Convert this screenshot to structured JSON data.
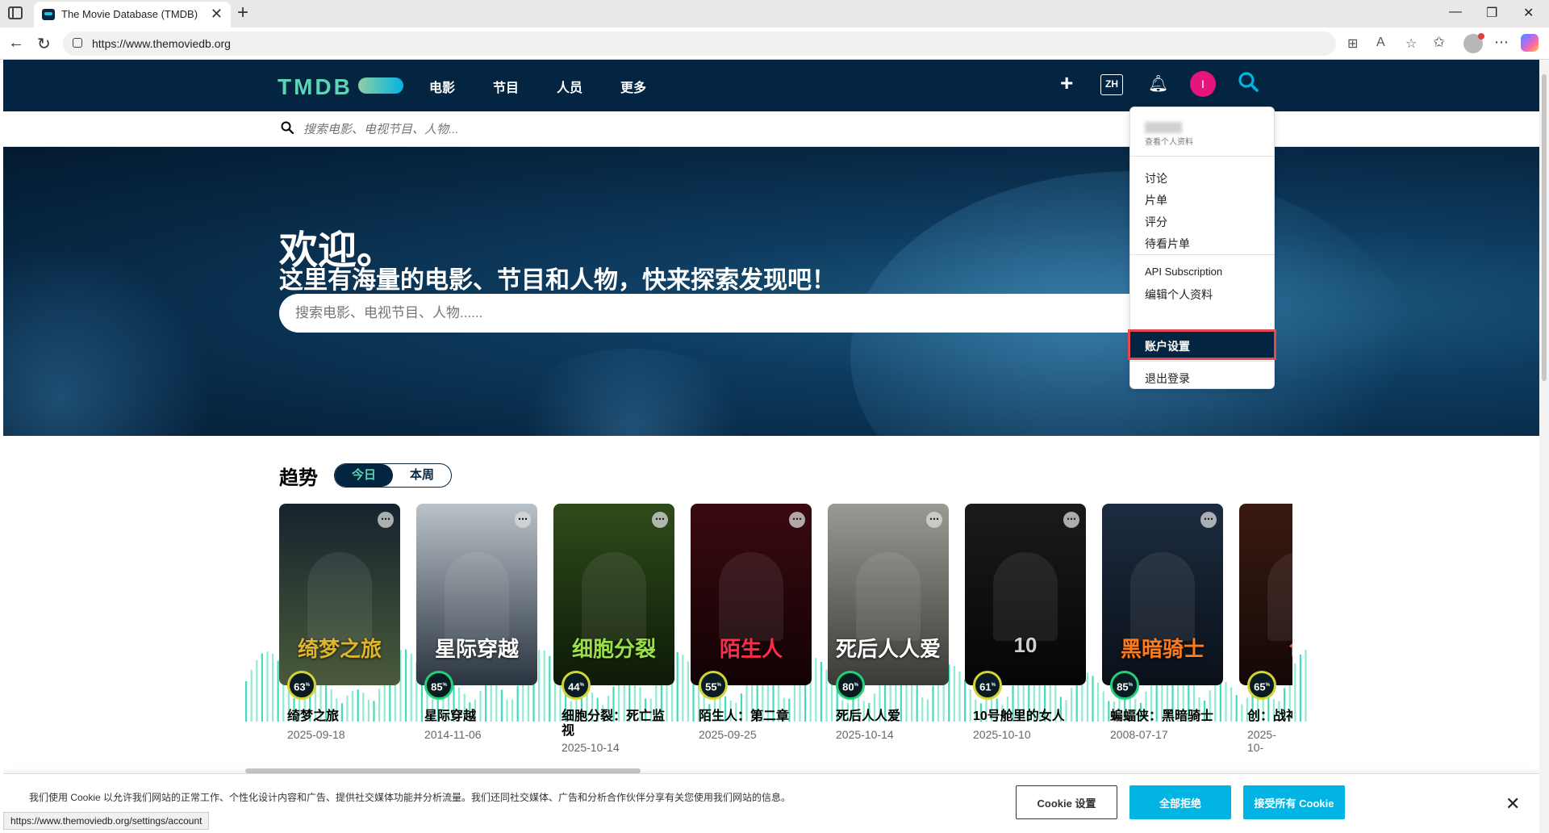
{
  "browser": {
    "tab_title": "The Movie Database (TMDB)",
    "url": "https://www.themoviedb.org",
    "status_url": "https://www.themoviedb.org/settings/account"
  },
  "header": {
    "logo": "TMDB",
    "menu": [
      "电影",
      "节目",
      "人员",
      "更多"
    ],
    "lang": "ZH",
    "avatar_letter": "I"
  },
  "subsearch": {
    "placeholder": "搜索电影、电视节目、人物..."
  },
  "hero": {
    "title": "欢迎。",
    "subtitle": "这里有海量的电影、节目和人物，快来探索发现吧！",
    "search_placeholder": "搜索电影、电视节目、人物......"
  },
  "dropdown": {
    "view_profile": "查看个人资料",
    "items": [
      "讨论",
      "片单",
      "评分",
      "待看片单"
    ],
    "items2": [
      "API Subscription",
      "编辑个人资料"
    ],
    "highlighted": "账户设置",
    "logout": "退出登录"
  },
  "trending": {
    "title": "趋势",
    "toggle": [
      "今日",
      "本周"
    ],
    "cards": [
      {
        "title": "绮梦之旅",
        "date": "2025-09-18",
        "score": "63",
        "poster_text": "绮梦之旅",
        "top": "#16232e",
        "bottom": "#4a5a3a",
        "accent": "#e0b52b"
      },
      {
        "title": "星际穿越",
        "date": "2014-11-06",
        "score": "85",
        "poster_text": "星际穿越",
        "top": "#b9c2c8",
        "bottom": "#2a3440",
        "accent": "#ffffff"
      },
      {
        "title": "细胞分裂：死亡监视",
        "date": "2025-10-14",
        "score": "44",
        "poster_text": "细胞分裂",
        "top": "#2f4b1a",
        "bottom": "#0e1a08",
        "accent": "#9be04a"
      },
      {
        "title": "陌生人：第二章",
        "date": "2025-09-25",
        "score": "55",
        "poster_text": "陌生人",
        "top": "#3a0a10",
        "bottom": "#120204",
        "accent": "#ff2b4a"
      },
      {
        "title": "死后人人爱",
        "date": "2025-10-14",
        "score": "80",
        "poster_text": "死后人人爱",
        "top": "#9a9a94",
        "bottom": "#3a3a36",
        "accent": "#ffffff"
      },
      {
        "title": "10号舱里的女人",
        "date": "2025-10-10",
        "score": "61",
        "poster_text": "10",
        "top": "#1b1b1b",
        "bottom": "#050505",
        "accent": "#cfcfcf"
      },
      {
        "title": "蝙蝠侠：黑暗骑士",
        "date": "2008-07-17",
        "score": "85",
        "poster_text": "黑暗骑士",
        "top": "#1c2c40",
        "bottom": "#0a1018",
        "accent": "#ff7a1a"
      },
      {
        "title": "创：战神",
        "date": "2025-10-",
        "score": "65",
        "poster_text": "创",
        "top": "#3a1a12",
        "bottom": "#140806",
        "accent": "#ff5a2a"
      }
    ]
  },
  "cookie": {
    "text": "我们使用 Cookie 以允许我们网站的正常工作、个性化设计内容和广告、提供社交媒体功能并分析流量。我们还同社交媒体、广告和分析合作伙伴分享有关您使用我们网站的信息。",
    "settings": "Cookie 设置",
    "reject": "全部拒绝",
    "accept": "接受所有 Cookie"
  }
}
